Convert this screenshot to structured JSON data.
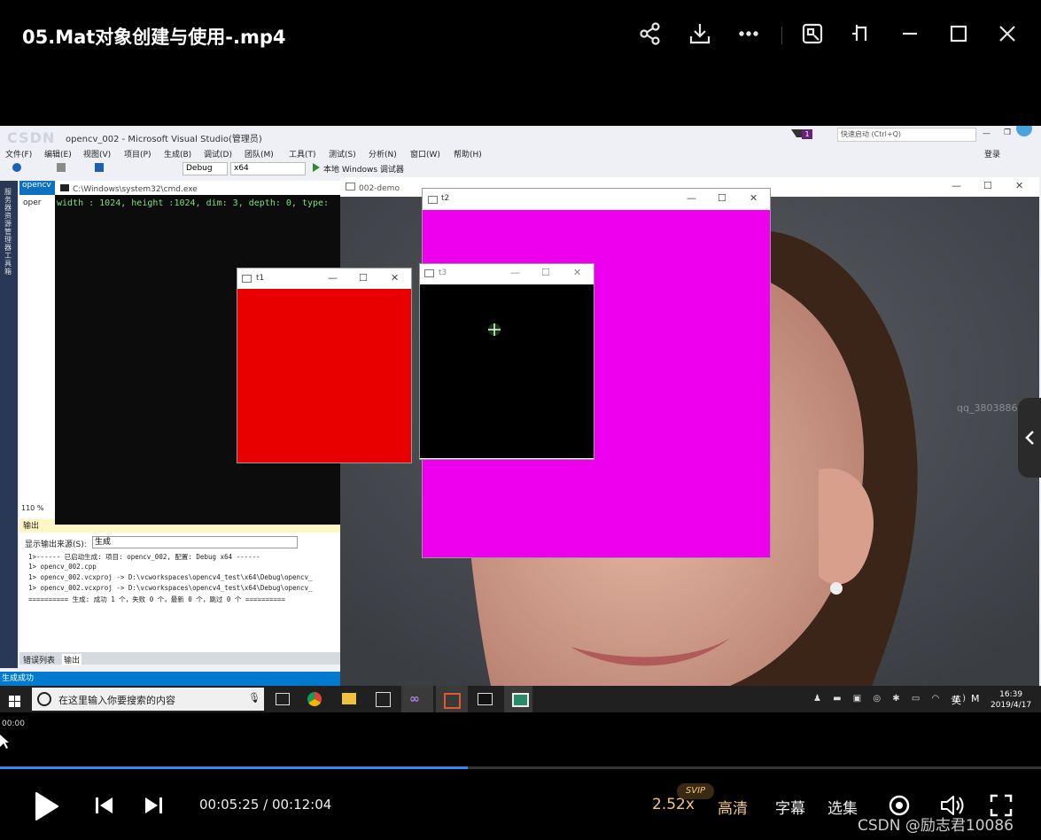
{
  "player": {
    "title": "05.Mat对象创建与使用-.mp4",
    "current_time": "00:05:25",
    "total_time": "00:12:04",
    "time_display": "00:05:25 / 00:12:04",
    "progress": 0.449,
    "speed": "2.52x",
    "svip_badge": "SVIP",
    "quality": "高清",
    "subtitles": "字幕",
    "episodes": "选集",
    "watermark": "CSDN @励志君10086",
    "scrub_time": "00:00",
    "accent": "#2a8bf2",
    "gold": "#f3c57e"
  },
  "top_icons": [
    "share-icon",
    "download-icon",
    "more-icon",
    "pip-icon",
    "pin-icon",
    "minimize-icon",
    "maximize-icon",
    "close-icon"
  ],
  "video": {
    "vs_title": "opencv_002 - Microsoft Visual Studio(管理员)",
    "vs_menus": [
      "文件(F)",
      "编辑(E)",
      "视图(V)",
      "项目(P)",
      "生成(B)",
      "调试(D)",
      "团队(M)",
      "工具(T)",
      "测试(S)",
      "分析(N)",
      "窗口(W)",
      "帮助(H)"
    ],
    "vs_config": "Debug",
    "vs_platform": "x64",
    "vs_debugger": "本地 Windows 调试器",
    "vs_quicklaunch": "快速启动 (Ctrl+Q)",
    "vs_login": "登录",
    "vs_badge": "1",
    "vs_sidebar": "服务器资源管理器 工具箱",
    "vs_tab": "opencv",
    "vs_file": "oper",
    "vs_zoom": "110 %",
    "cmd_title": "C:\\Windows\\system32\\cmd.exe",
    "cmd_line": "width : 1024, height :1024, dim: 3, depth: 0, type:",
    "demo_title": "002-demo",
    "t1_title": "t1",
    "t2_title": "t2",
    "t3_title": "t3",
    "t1_color": "#e80000",
    "t2_color": "#ee00ee",
    "t3_color": "#000000",
    "side_watermark": "qq_3803886",
    "output_header": "输出",
    "output_source_label": "显示输出来源(S):",
    "output_source": "生成",
    "output_lines": [
      "1>------ 已启动生成: 项目: opencv_002, 配置: Debug x64 ------",
      "1>  opencv_002.cpp",
      "1>  opencv_002.vcxproj -> D:\\vcworkspaces\\opencv4_test\\x64\\Debug\\opencv_",
      "1>  opencv_002.vcxproj -> D:\\vcworkspaces\\opencv4_test\\x64\\Debug\\opencv_",
      "========== 生成: 成功 1 个，失败 0 个，最新 0 个，跳过 0 个 =========="
    ],
    "output_tabs": [
      "错误列表",
      "输出"
    ],
    "status": "生成成功",
    "taskbar_search": "在这里输入你要搜索的内容",
    "tray_lang": "英",
    "tray_time": "16:39",
    "tray_date": "2019/4/17",
    "csdn_logo": "CSDN"
  }
}
